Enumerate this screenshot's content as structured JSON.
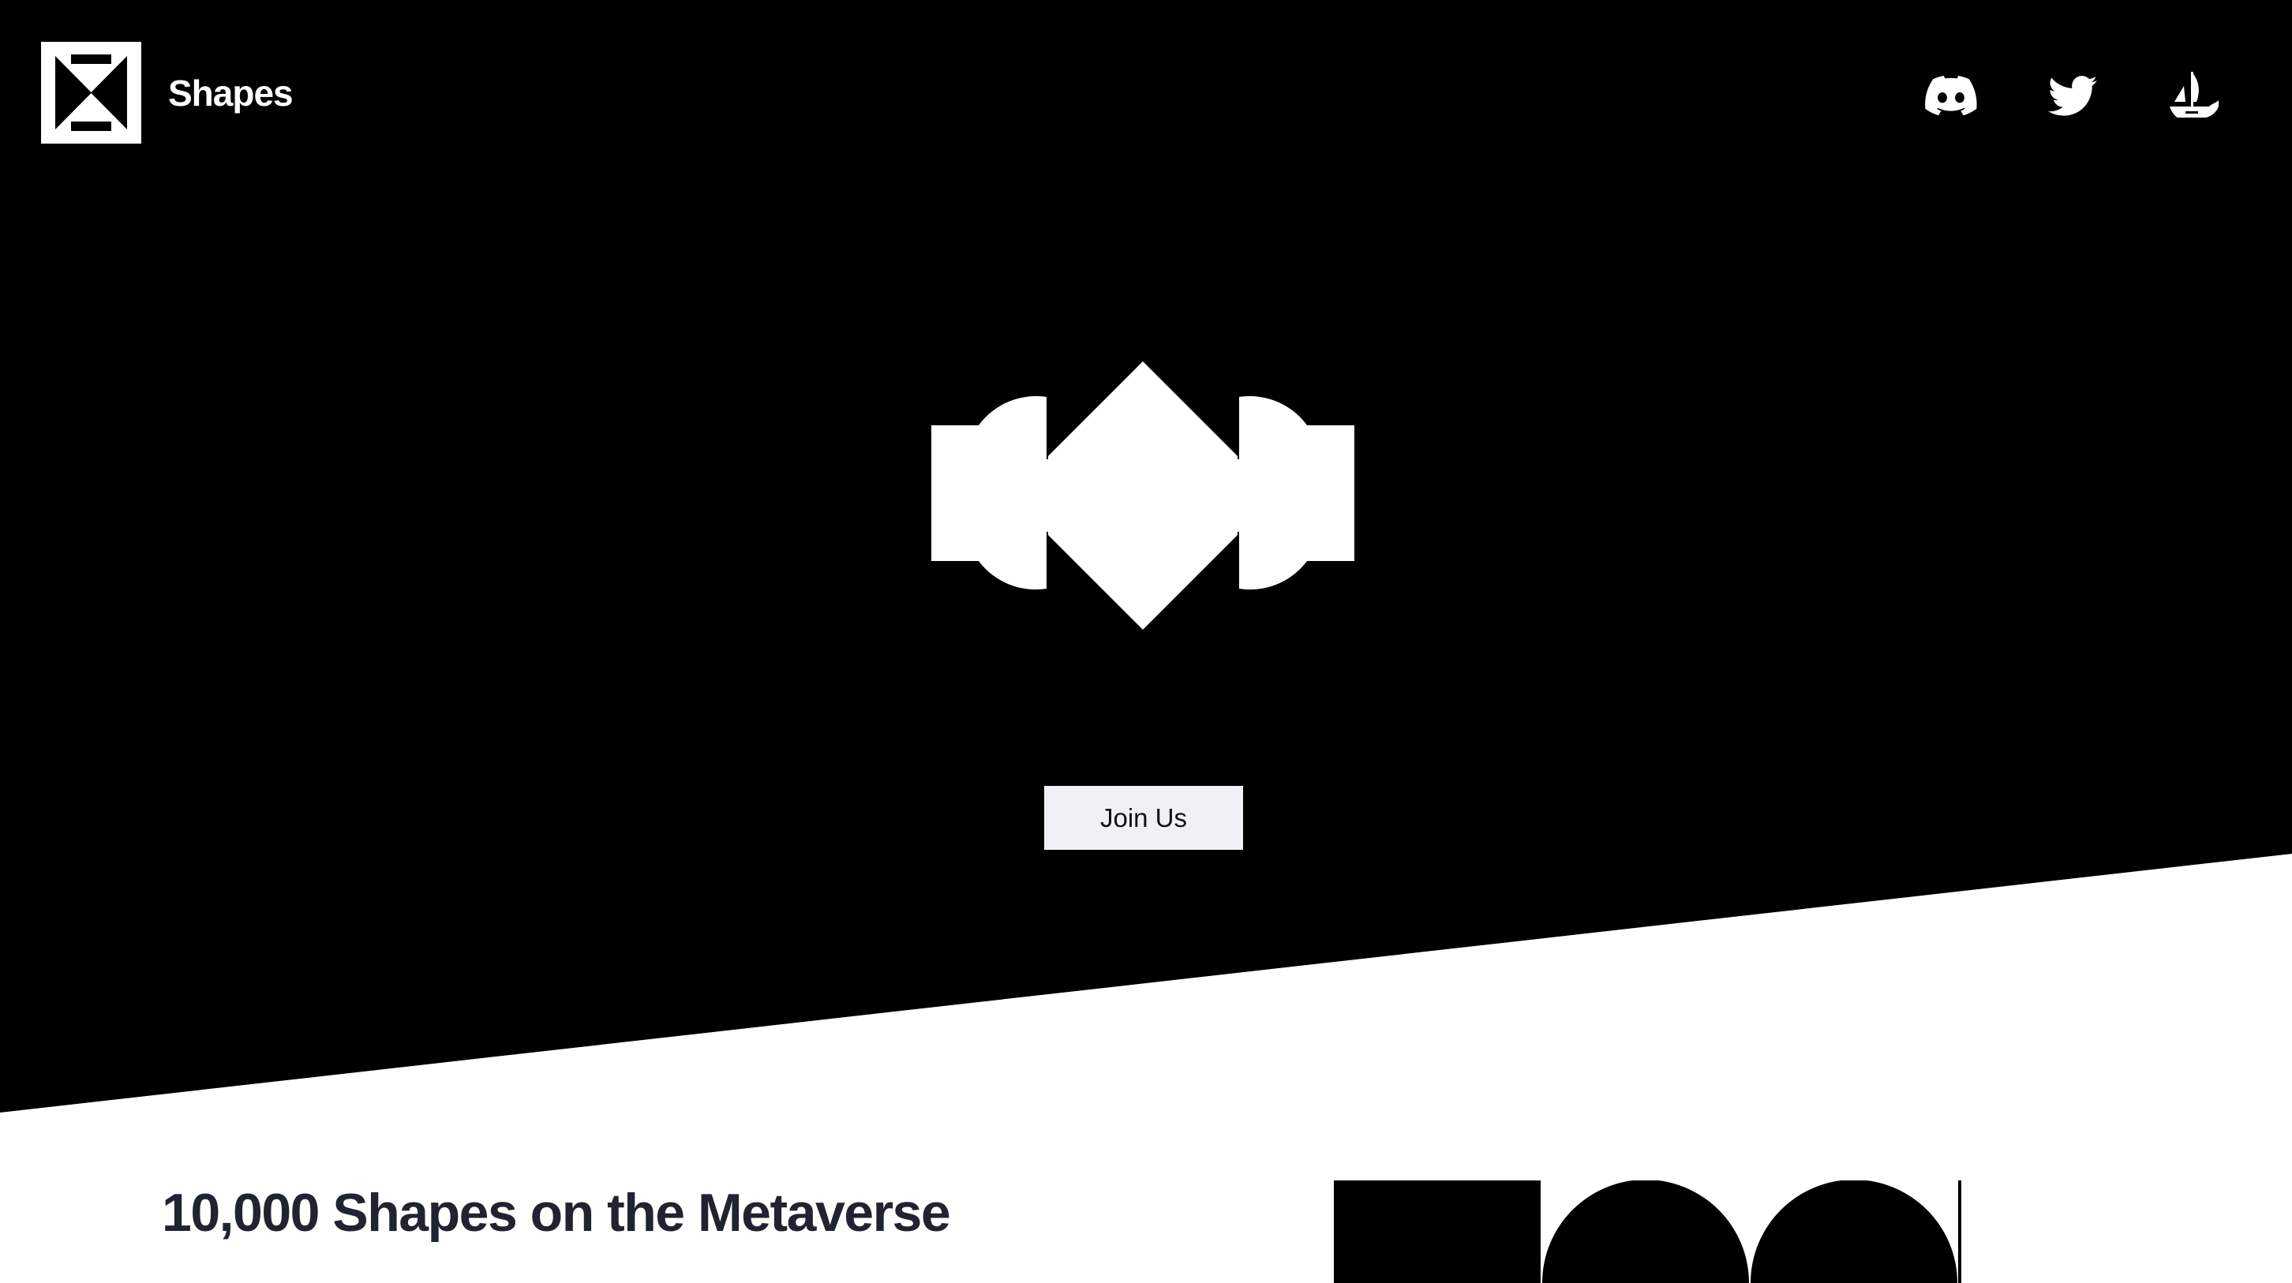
{
  "header": {
    "brand_name": "Shapes",
    "social_links": [
      {
        "icon": "discord-icon",
        "label": "Discord"
      },
      {
        "icon": "twitter-icon",
        "label": "Twitter"
      },
      {
        "icon": "opensea-icon",
        "label": "OpenSea"
      }
    ]
  },
  "hero": {
    "cta_label": "Join Us"
  },
  "about": {
    "title": "10,000 Shapes on the Metaverse"
  },
  "colors": {
    "background_dark": "#000000",
    "background_light": "#ffffff",
    "button_bg": "#eef2f6",
    "heading_text": "#1f2430"
  }
}
